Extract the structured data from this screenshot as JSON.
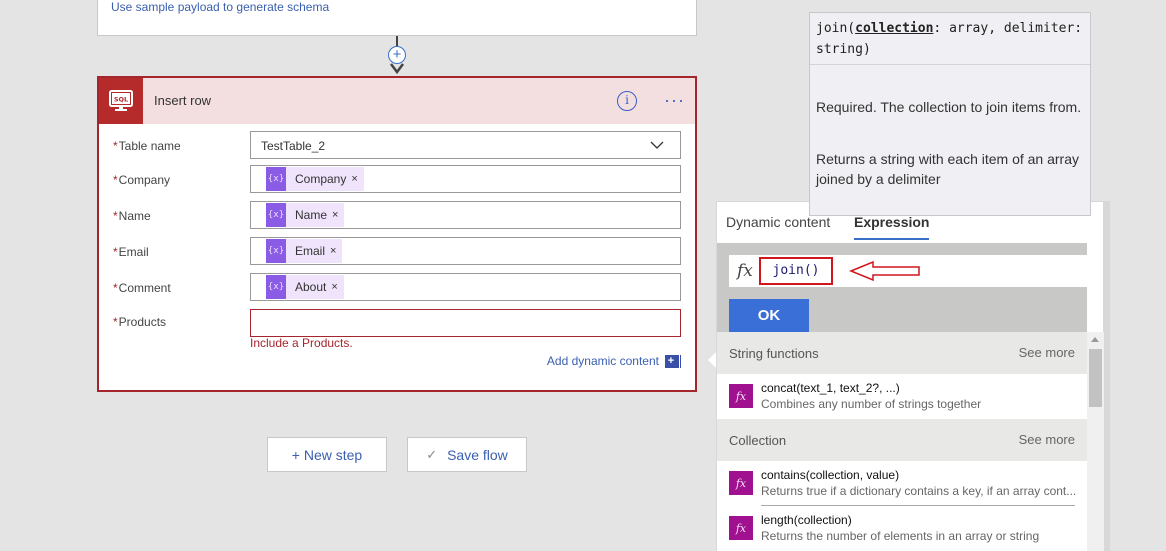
{
  "previous_step": {
    "schema_link": "Use sample payload to generate schema"
  },
  "connector": {
    "add_icon": "plus-icon",
    "arrow_icon": "arrow-down-icon"
  },
  "action_card": {
    "icon": "sql-server-icon",
    "icon_label": "SQL",
    "title": "Insert row",
    "info_icon": "info-icon",
    "more_icon": "more-options-icon",
    "accent_color": "#a4262c",
    "fields": [
      {
        "label": "Table name",
        "required": "*",
        "type": "dropdown",
        "value": "TestTable_2"
      },
      {
        "label": "Company",
        "required": "*",
        "type": "token",
        "token": "Company"
      },
      {
        "label": "Name",
        "required": "*",
        "type": "token",
        "token": "Name"
      },
      {
        "label": "Email",
        "required": "*",
        "type": "token",
        "token": "Email"
      },
      {
        "label": "Comment",
        "required": "*",
        "type": "token",
        "token": "About"
      },
      {
        "label": "Products",
        "required": "*",
        "type": "text",
        "value": ""
      }
    ],
    "token_icon_glyph": "{x}",
    "token_remove": "×",
    "error_message": "Include a Products.",
    "add_dynamic_content": "Add dynamic content",
    "add_dynamic_icon": "+"
  },
  "buttons": {
    "new_step": "+ New step",
    "save_flow": "Save flow",
    "save_icon": "✓"
  },
  "tooltip": {
    "sig_prefix": "join(",
    "sig_param": "collection",
    "sig_rest": ": array, delimiter: string)",
    "param_desc": "Required. The collection to join items from.",
    "fn_desc": "Returns a string with each item of an array joined by a delimiter"
  },
  "expression_panel": {
    "tabs": [
      {
        "label": "Dynamic content",
        "active": false
      },
      {
        "label": "Expression",
        "active": true
      }
    ],
    "fx_label": "fx",
    "expression_value": "join()",
    "ok_label": "OK",
    "accent_color": "#3a6fd8",
    "sections": [
      {
        "title": "String functions",
        "see_more": "See more",
        "items": [
          {
            "name": "concat(text_1, text_2?, ...)",
            "desc": "Combines any number of strings together"
          }
        ]
      },
      {
        "title": "Collection",
        "see_more": "See more",
        "items": [
          {
            "name": "contains(collection, value)",
            "desc": "Returns true if a dictionary contains a key, if an array cont..."
          },
          {
            "name": "length(collection)",
            "desc": "Returns the number of elements in an array or string"
          }
        ]
      }
    ]
  }
}
